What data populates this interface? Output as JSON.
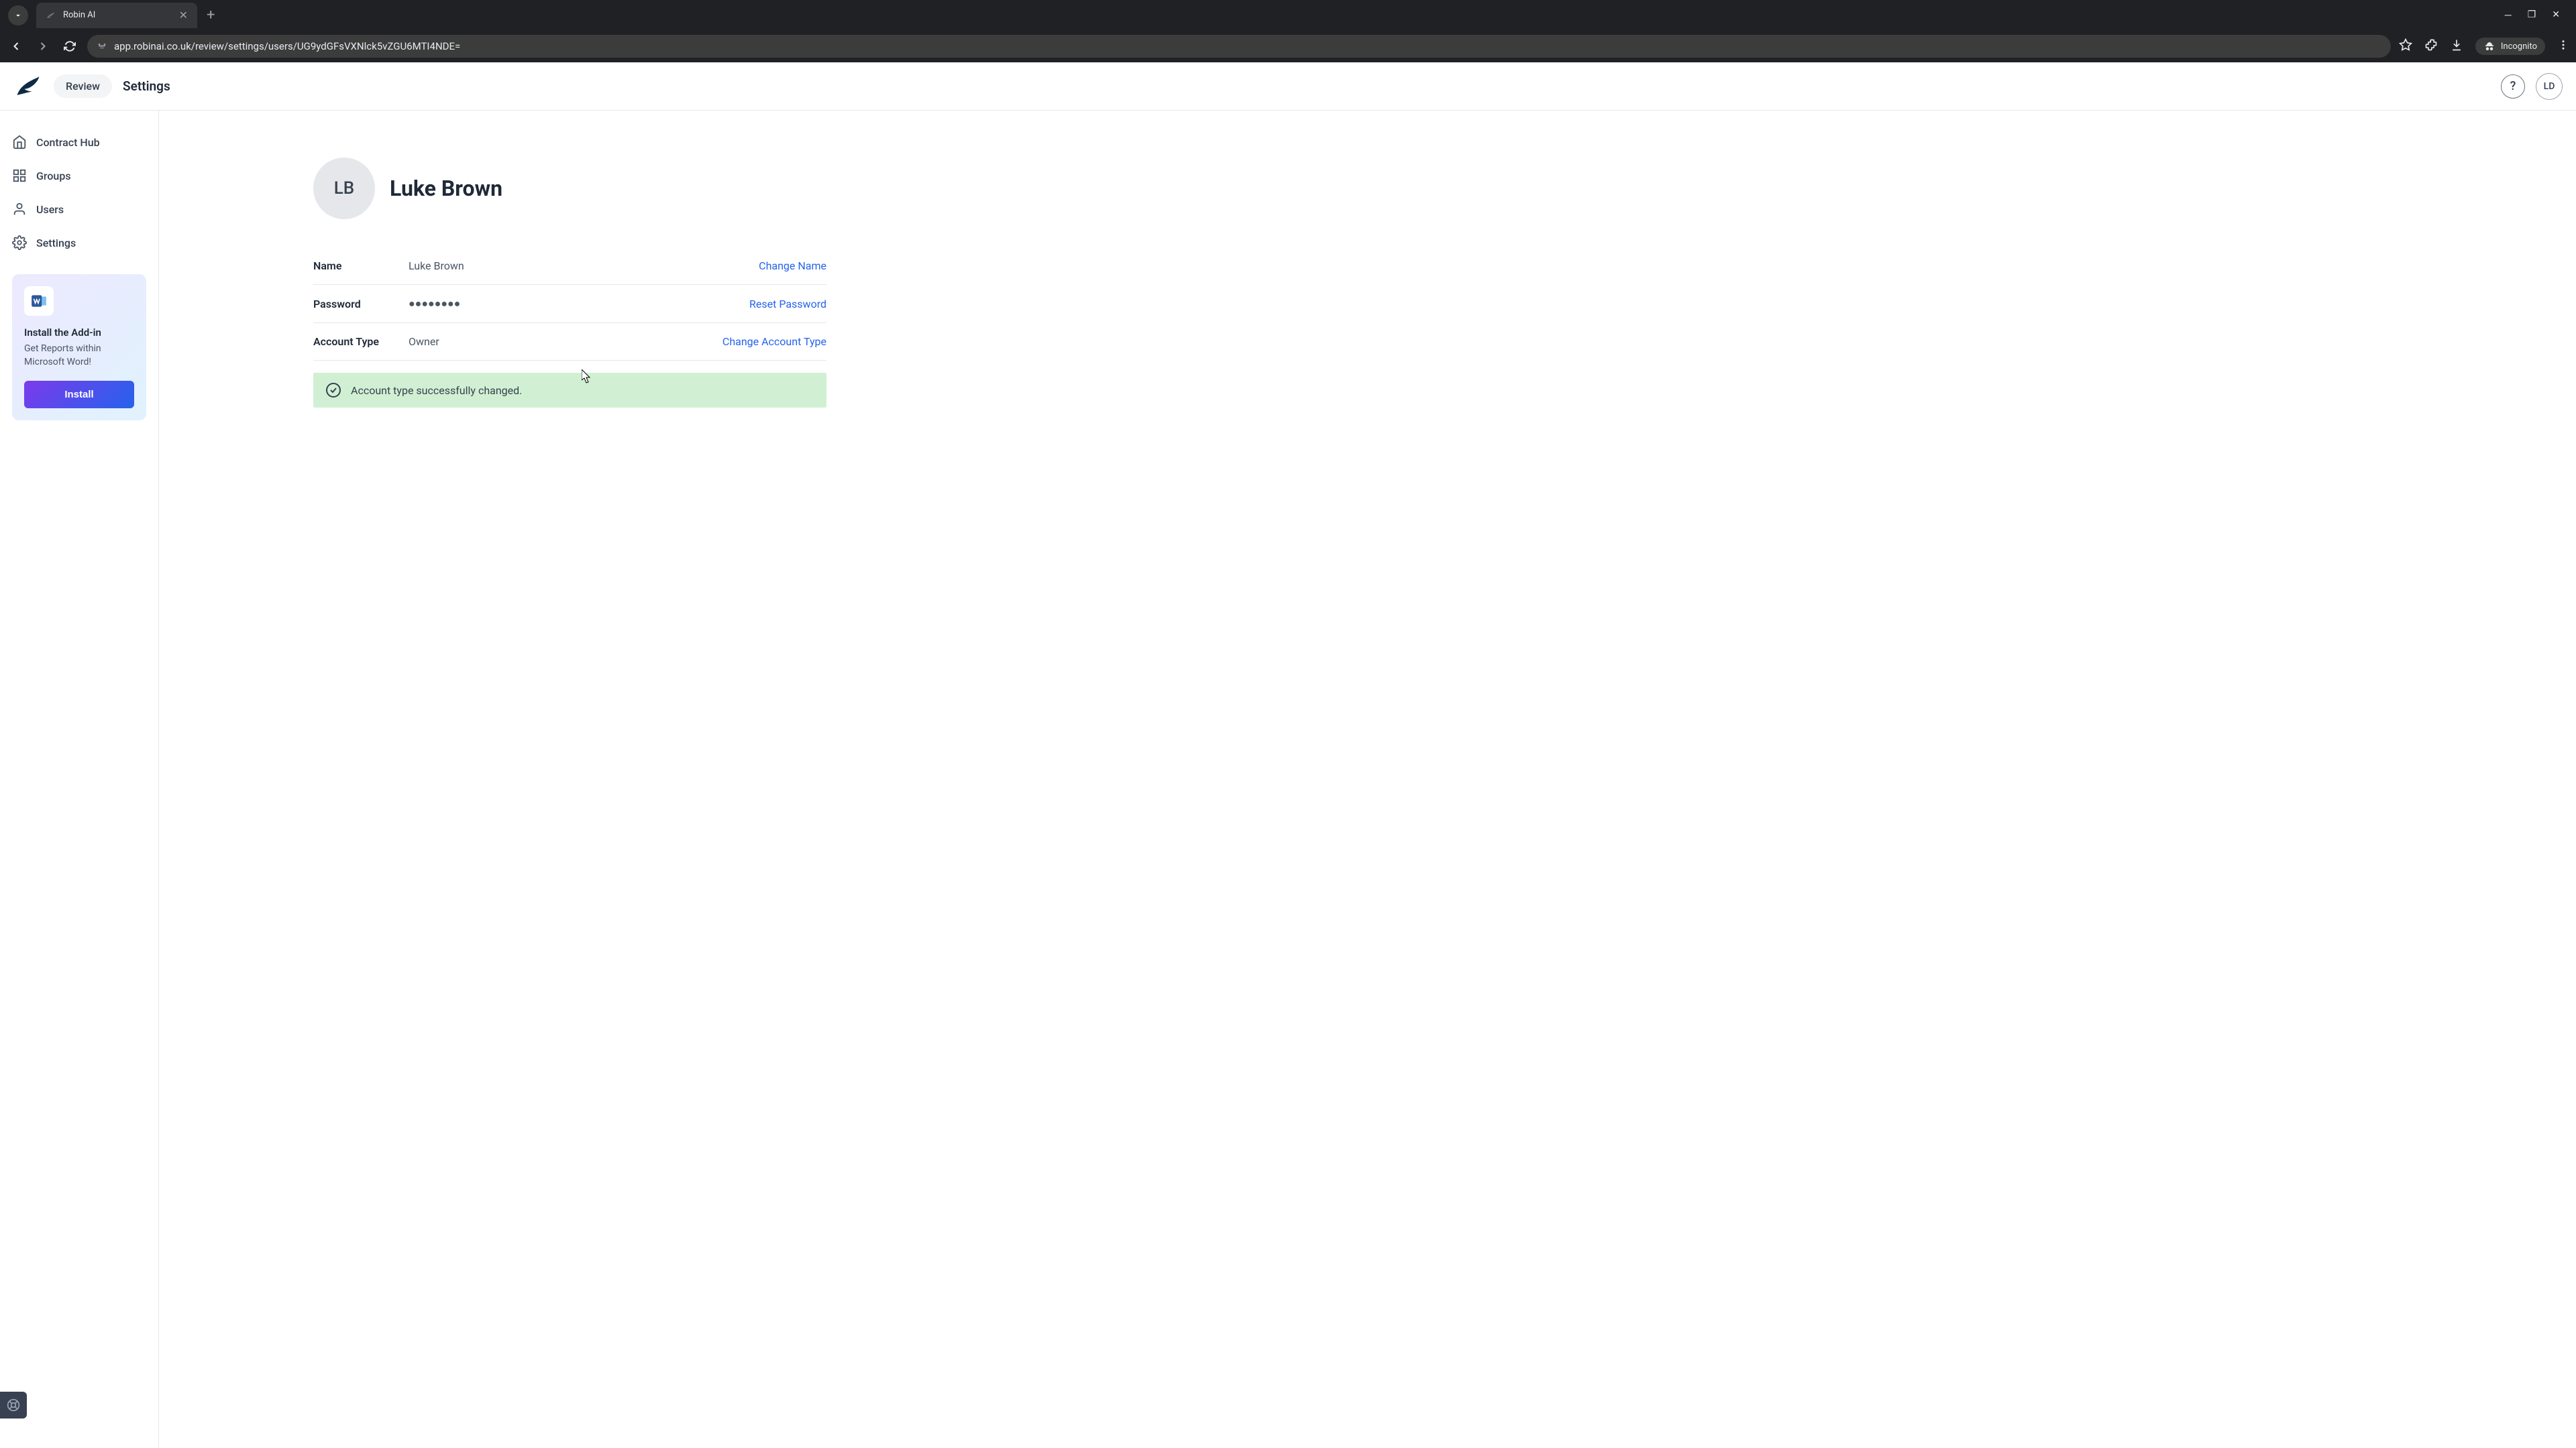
{
  "browser": {
    "tab_title": "Robin AI",
    "url": "app.robinai.co.uk/review/settings/users/UG9ydGFsVXNlck5vZGU6MTI4NDE=",
    "incognito_label": "Incognito"
  },
  "header": {
    "review_label": "Review",
    "settings_label": "Settings",
    "avatar_initials": "LD"
  },
  "sidebar": {
    "items": [
      {
        "label": "Contract Hub",
        "icon": "home-icon"
      },
      {
        "label": "Groups",
        "icon": "grid-icon"
      },
      {
        "label": "Users",
        "icon": "users-icon"
      },
      {
        "label": "Settings",
        "icon": "gear-icon"
      }
    ],
    "promo": {
      "title": "Install the Add-in",
      "description": "Get Reports within Microsoft Word!",
      "button": "Install"
    }
  },
  "user": {
    "avatar_initials": "LB",
    "display_name": "Luke Brown",
    "rows": [
      {
        "label": "Name",
        "value": "Luke Brown",
        "action": "Change Name"
      },
      {
        "label": "Password",
        "value": "●●●●●●●●",
        "action": "Reset Password"
      },
      {
        "label": "Account Type",
        "value": "Owner",
        "action": "Change Account Type"
      }
    ]
  },
  "banner": {
    "message": "Account type successfully changed."
  }
}
